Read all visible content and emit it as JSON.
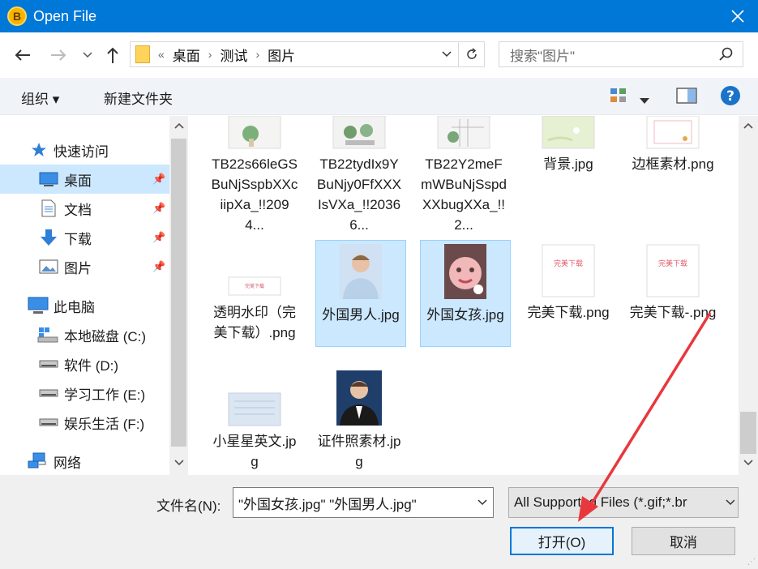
{
  "window": {
    "title": "Open File"
  },
  "address": {
    "overflow": "«",
    "crumbs": [
      "桌面",
      "测试",
      "图片"
    ],
    "search_placeholder": "搜索\"图片\""
  },
  "toolbar": {
    "organize": "组织 ▾",
    "new_folder": "新建文件夹"
  },
  "sidebar": {
    "quick_access": "快速访问",
    "desktop": "桌面",
    "documents": "文档",
    "downloads": "下载",
    "pictures": "图片",
    "this_pc": "此电脑",
    "drive_c": "本地磁盘 (C:)",
    "drive_d": "软件 (D:)",
    "drive_e": "学习工作 (E:)",
    "drive_f": "娱乐生活 (F:)",
    "network": "网络"
  },
  "files": [
    {
      "name": "TB22s66leGSBuNjSspbXXciipXa_!!2094...",
      "selected": false
    },
    {
      "name": "TB22tydIx9YBuNjy0FfXXXIsVXa_!!20366...",
      "selected": false
    },
    {
      "name": "TB22Y2meFmWBuNjSspdXXbugXXa_!!2...",
      "selected": false
    },
    {
      "name": "背景.jpg",
      "selected": false
    },
    {
      "name": "边框素材.png",
      "selected": false
    },
    {
      "name": "透明水印（完美下载）.png",
      "selected": false
    },
    {
      "name": "外国男人.jpg",
      "selected": true
    },
    {
      "name": "外国女孩.jpg",
      "selected": true
    },
    {
      "name": "完美下载.png",
      "selected": false
    },
    {
      "name": "完美下载-.png",
      "selected": false
    },
    {
      "name": "小星星英文.jpg",
      "selected": false
    },
    {
      "name": "证件照素材.jpg",
      "selected": false
    }
  ],
  "thumb_text": {
    "watermark": "完美下载",
    "small": "完美下载"
  },
  "bottom": {
    "filename_label": "文件名(N):",
    "filename_value": "\"外国女孩.jpg\" \"外国男人.jpg\"",
    "filetype_value": "All Supported Files (*.gif;*.br",
    "open_button": "打开(O)",
    "cancel_button": "取消"
  },
  "colors": {
    "titlebar": "#0078d7",
    "selection": "#cce8ff",
    "annotation_arrow": "#e8383d"
  }
}
